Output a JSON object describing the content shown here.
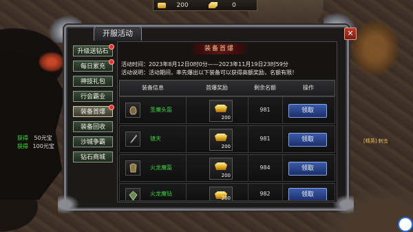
{
  "resources": [
    {
      "icon": "gold-coin-icon",
      "value": "200"
    },
    {
      "icon": "gold-ingot-icon",
      "value": "0"
    }
  ],
  "hud": {
    "gains": [
      {
        "label": "获得",
        "amount": "50元宝"
      },
      {
        "label": "获得",
        "amount": "100元宝"
      }
    ],
    "npc_label": "[精英] 刺虫"
  },
  "panel": {
    "title": "开服活动",
    "close_label": "✕"
  },
  "sidebar": {
    "items": [
      {
        "label": "升级送钻石",
        "red_dot": true,
        "active": false
      },
      {
        "label": "每日累充",
        "red_dot": true,
        "active": false
      },
      {
        "label": "神技礼包",
        "red_dot": false,
        "active": false
      },
      {
        "label": "行会霸业",
        "red_dot": false,
        "active": false
      },
      {
        "label": "装备首爆",
        "red_dot": true,
        "active": true
      },
      {
        "label": "装备回收",
        "red_dot": false,
        "active": false
      },
      {
        "label": "沙城争霸",
        "red_dot": false,
        "active": false
      },
      {
        "label": "钻石商城",
        "red_dot": false,
        "active": false
      }
    ]
  },
  "content": {
    "banner": "装备首爆",
    "time_line": "活动时间：2023年8月12日0时0分——2023年11月19日23时59分",
    "desc_line": "活动说明：活动期间，率先爆出以下装备可以获得高额奖励，名额有限！",
    "columns": [
      "装备信息",
      "首爆奖励",
      "剩余名额",
      "操作"
    ],
    "rows": [
      {
        "name": "圣魔头盔",
        "icon": "helmet-icon",
        "reward_qty": "200",
        "remaining": "981",
        "action": "领取"
      },
      {
        "name": "镇天",
        "icon": "sword-icon",
        "reward_qty": "200",
        "remaining": "981",
        "action": "领取"
      },
      {
        "name": "火龙魔盔",
        "icon": "armor-icon",
        "reward_qty": "200",
        "remaining": "984",
        "action": "领取"
      },
      {
        "name": "火龙魔钻",
        "icon": "gem-icon",
        "reward_qty": "200",
        "remaining": "982",
        "action": "领取"
      }
    ]
  },
  "colors": {
    "item_name": "#3cd23c",
    "claim_button": "#2a46a0",
    "red_dot": "#e8312a",
    "hud_green": "#33e633"
  }
}
